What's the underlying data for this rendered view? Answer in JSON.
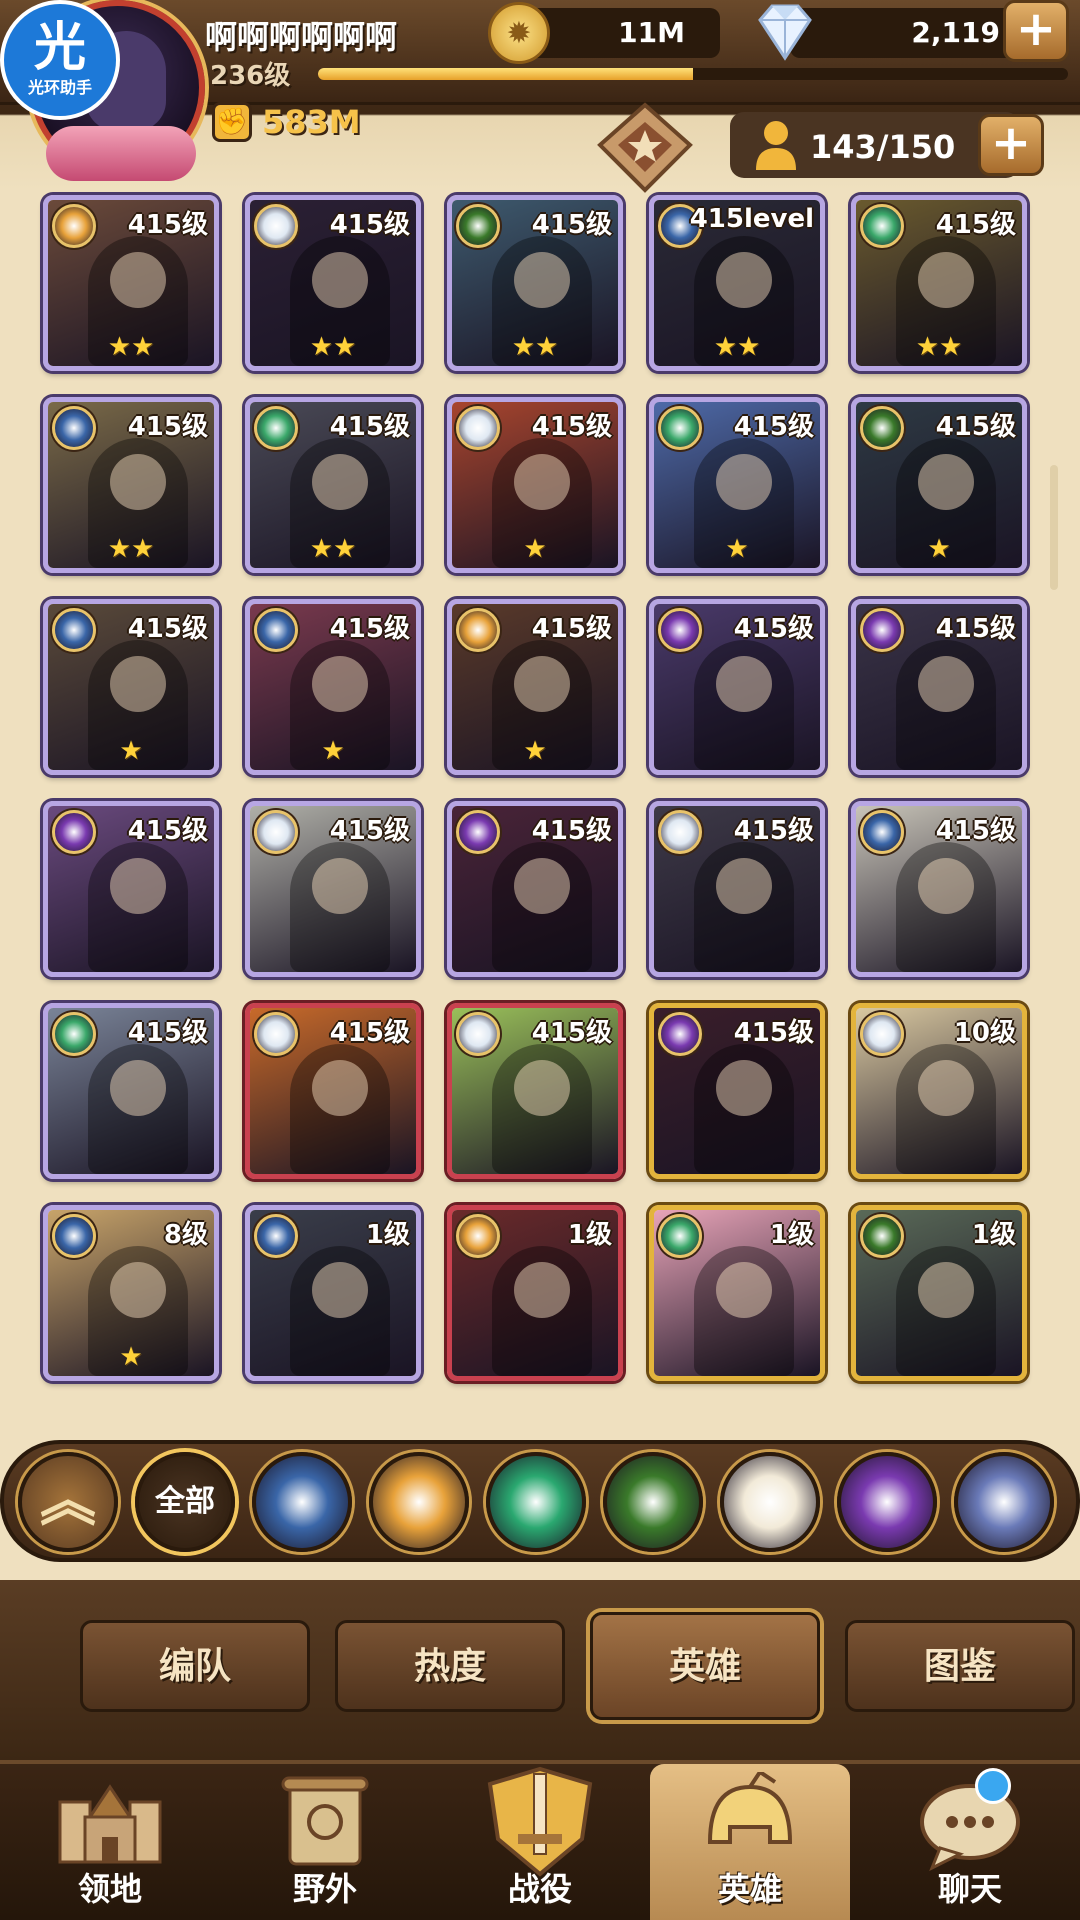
{
  "header": {
    "assist_badge": {
      "char": "光",
      "label": "光环助手"
    },
    "player_name": "啊啊啊啊啊啊",
    "player_level": "236级",
    "exp_progress": 0.5,
    "power": "583M",
    "gold": "11M",
    "gems": "2,119",
    "roster": "143/150",
    "plus": "+"
  },
  "heroes": [
    {
      "level": "415级",
      "faction": "tidal",
      "stars": "★★",
      "tier": "legend",
      "color": "#6b4a3a"
    },
    {
      "level": "415级",
      "faction": "celestial",
      "stars": "★★",
      "tier": "legend",
      "color": "#2b2034"
    },
    {
      "level": "415级",
      "faction": "wilder",
      "stars": "★★",
      "tier": "legend",
      "color": "#3e5a6e"
    },
    {
      "level": "415level",
      "faction": "lightbearer",
      "stars": "★★",
      "tier": "legend",
      "color": "#2a2a36"
    },
    {
      "level": "415级",
      "faction": "graveborn",
      "stars": "★★",
      "tier": "legend",
      "color": "#6a5a2e"
    },
    {
      "level": "415级",
      "faction": "lightbearer",
      "stars": "★★",
      "tier": "legend",
      "color": "#7a6a48"
    },
    {
      "level": "415级",
      "faction": "graveborn",
      "stars": "★★",
      "tier": "legend",
      "color": "#4a4a56"
    },
    {
      "level": "415级",
      "faction": "celestial",
      "stars": "★",
      "tier": "legend",
      "color": "#a8452e"
    },
    {
      "level": "415级",
      "faction": "graveborn",
      "stars": "★",
      "tier": "legend",
      "color": "#4e6aa8"
    },
    {
      "level": "415级",
      "faction": "wilder",
      "stars": "★",
      "tier": "legend",
      "color": "#2e3a44"
    },
    {
      "level": "415级",
      "faction": "lightbearer",
      "stars": "★",
      "tier": "legend",
      "color": "#5a4a3a"
    },
    {
      "level": "415级",
      "faction": "lightbearer",
      "stars": "★",
      "tier": "legend",
      "color": "#7a3a4e"
    },
    {
      "level": "415级",
      "faction": "tidal",
      "stars": "★",
      "tier": "legend",
      "color": "#5a3a2a"
    },
    {
      "level": "415级",
      "faction": "hypogean",
      "stars": "",
      "tier": "legend",
      "color": "#4a3a6a"
    },
    {
      "level": "415级",
      "faction": "hypogean",
      "stars": "",
      "tier": "legend",
      "color": "#3a3448"
    },
    {
      "level": "415级",
      "faction": "hypogean",
      "stars": "",
      "tier": "legend",
      "color": "#6a4a7e"
    },
    {
      "level": "415级",
      "faction": "celestial",
      "stars": "",
      "tier": "legend",
      "color": "#b0b0a8"
    },
    {
      "level": "415级",
      "faction": "hypogean",
      "stars": "",
      "tier": "legend",
      "color": "#4a2438"
    },
    {
      "level": "415级",
      "faction": "celestial",
      "stars": "",
      "tier": "legend",
      "color": "#3e3a48"
    },
    {
      "level": "415级",
      "faction": "lightbearer",
      "stars": "",
      "tier": "legend",
      "color": "#c8c4b8"
    },
    {
      "level": "415级",
      "faction": "graveborn",
      "stars": "",
      "tier": "legend",
      "color": "#7a8498"
    },
    {
      "level": "415级",
      "faction": "celestial",
      "stars": "",
      "tier": "red",
      "color": "#c86a2a"
    },
    {
      "level": "415级",
      "faction": "celestial",
      "stars": "",
      "tier": "red",
      "color": "#9ac05a"
    },
    {
      "level": "415级",
      "faction": "hypogean",
      "stars": "",
      "tier": "gold",
      "color": "#3a1e2a"
    },
    {
      "level": "10级",
      "faction": "celestial",
      "stars": "",
      "tier": "gold",
      "color": "#d9c8a0"
    },
    {
      "level": "8级",
      "faction": "lightbearer",
      "stars": "★",
      "tier": "legend",
      "color": "#c8a46a"
    },
    {
      "level": "1级",
      "faction": "lightbearer",
      "stars": "",
      "tier": "legend",
      "color": "#3a3e4a"
    },
    {
      "level": "1级",
      "faction": "tidal",
      "stars": "",
      "tier": "red",
      "color": "#6a2a2a"
    },
    {
      "level": "1级",
      "faction": "graveborn",
      "stars": "",
      "tier": "gold",
      "color": "#e8a4b8"
    },
    {
      "level": "1级",
      "faction": "wilder",
      "stars": "",
      "tier": "gold",
      "color": "#5a6a58"
    }
  ],
  "faction_colors": {
    "tidal": "#e8a23a",
    "celestial": "#dfe8f2",
    "wilder": "#3a7a2a",
    "lightbearer": "#3a66a8",
    "graveborn": "#3aa86a",
    "hypogean": "#7a3ab0"
  },
  "filters": {
    "up": "︽",
    "all": "全部",
    "items": [
      {
        "name": "lightbearer",
        "color": "#3a66a8"
      },
      {
        "name": "mauler",
        "color": "#e8a23a"
      },
      {
        "name": "wilder",
        "color": "#2aa870"
      },
      {
        "name": "graveborn",
        "color": "#3a7a2a"
      },
      {
        "name": "celestial",
        "color": "#f2ead8"
      },
      {
        "name": "hypogean",
        "color": "#7a3ab0"
      },
      {
        "name": "dimensional",
        "color": "#6a7ab8"
      }
    ]
  },
  "tabs": [
    "编队",
    "热度",
    "英雄",
    "图鉴"
  ],
  "nav": [
    "领地",
    "野外",
    "战役",
    "英雄",
    "聊天"
  ]
}
